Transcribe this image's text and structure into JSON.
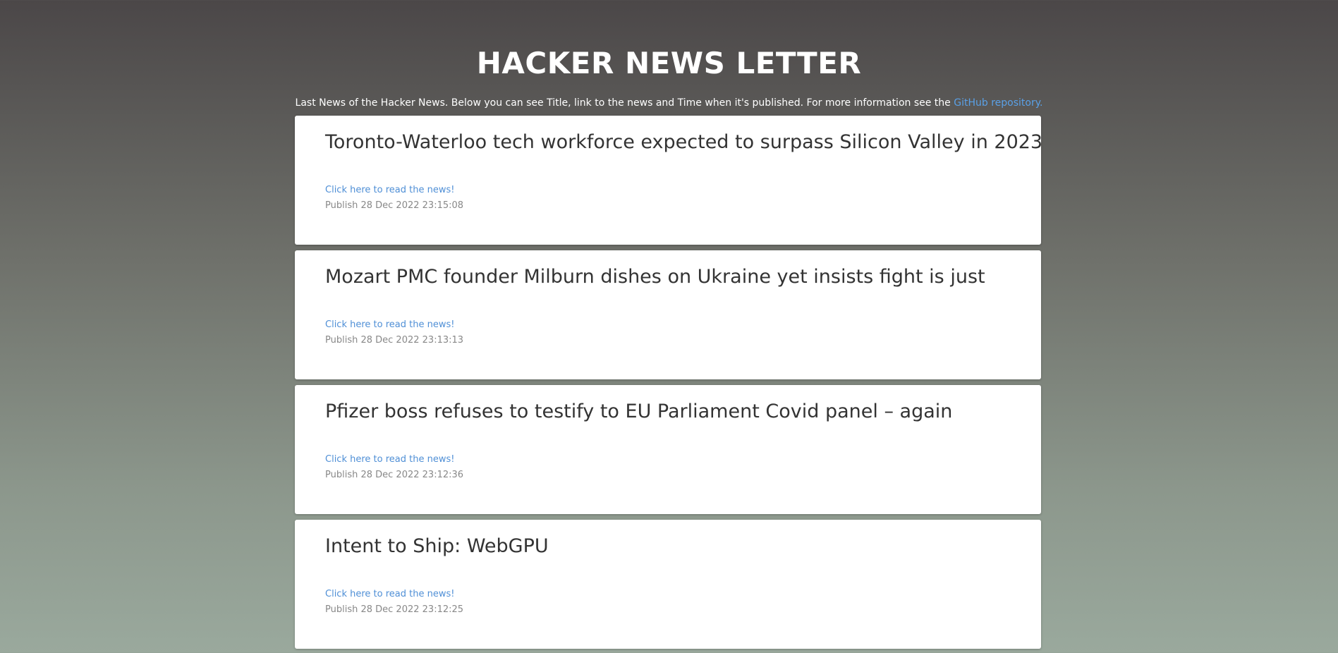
{
  "header": {
    "title": "HACKER NEWS LETTER",
    "subtitle_text": "Last News of the Hacker News. Below you can see Title, link to the news and Time when it's published. For more information see the ",
    "repo_link_label": "GitHub repository."
  },
  "colors": {
    "link": "#4f8fd6",
    "repo_link": "#5aa0e6",
    "title_text": "#ffffff",
    "card_bg": "#ffffff"
  },
  "news": [
    {
      "title": "Toronto-Waterloo tech workforce expected to surpass Silicon Valley in 2023",
      "link_label": "Click here to read the news!",
      "published": "Publish 28 Dec 2022 23:15:08"
    },
    {
      "title": "Mozart PMC founder Milburn dishes on Ukraine yet insists fight is just",
      "link_label": "Click here to read the news!",
      "published": "Publish 28 Dec 2022 23:13:13"
    },
    {
      "title": "Pfizer boss refuses to testify to EU Parliament Covid panel – again",
      "link_label": "Click here to read the news!",
      "published": "Publish 28 Dec 2022 23:12:36"
    },
    {
      "title": "Intent to Ship: WebGPU",
      "link_label": "Click here to read the news!",
      "published": "Publish 28 Dec 2022 23:12:25"
    }
  ]
}
